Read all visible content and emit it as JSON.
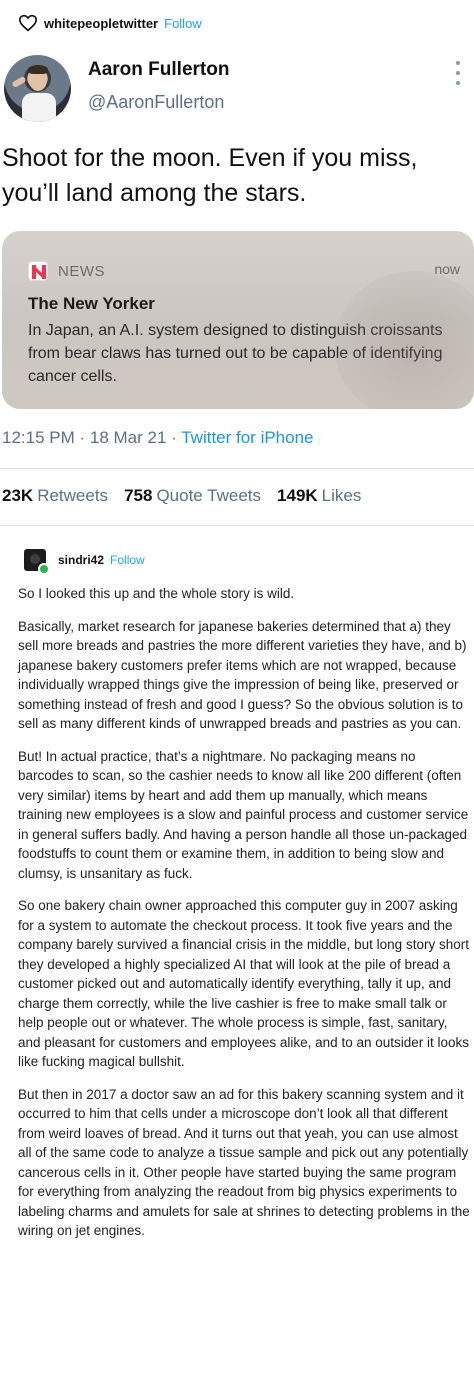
{
  "repost": {
    "username": "whitepeopletwitter",
    "follow_label": "Follow"
  },
  "tweet": {
    "author_name": "Aaron Fullerton",
    "author_handle": "@AaronFullerton",
    "text": "Shoot for the moon. Even if you miss, you’ll land among the stars.",
    "notification": {
      "app": "NEWS",
      "time": "now",
      "title": "The New Yorker",
      "body": "In Japan, an A.I. system designed to distinguish croissants from bear claws has turned out to be capable of identifying cancer cells."
    },
    "timestamp": "12:15 PM · 18 Mar 21 · ",
    "source": "Twitter for iPhone",
    "retweets_count": "23K",
    "retweets_label": "Retweets",
    "quotes_count": "758",
    "quotes_label": "Quote Tweets",
    "likes_count": "149K",
    "likes_label": "Likes"
  },
  "reply": {
    "username": "sindri42",
    "follow_label": "Follow",
    "paragraphs": [
      "So I looked this up and the whole story is wild.",
      "Basically, market research for japanese bakeries determined that a) they sell more breads and pastries the more different varieties they have, and b) japanese bakery customers prefer items which are not wrapped, because individually wrapped things give the impression of being like, preserved or something instead of fresh and good I guess? So the obvious solution is to sell as many different kinds of unwrapped breads and pastries as you can.",
      "But! In actual practice, that’s a nightmare. No packaging means no barcodes to scan, so the cashier needs to know all like 200 different (often very similar) items by heart and add them up manually, which means training new employees is a slow and painful process and customer service in general suffers badly. And having a person handle all those un-packaged foodstuffs to count them or examine them, in addition to being slow and clumsy, is unsanitary as fuck.",
      "So one bakery chain owner approached this computer guy in 2007 asking for a system to automate the checkout process. It took five years and the company barely survived a financial crisis in the middle, but long story short they developed a highly specialized AI that will look at the pile of bread a customer picked out and automatically identify everything, tally it up, and charge them correctly, while the live cashier is free to make small talk or help people out or whatever. The whole process is simple, fast, sanitary, and pleasant for customers and employees alike, and to an outsider it looks like fucking magical bullshit.",
      "But then in 2017 a doctor saw an ad for this bakery scanning system and it occurred to him that cells under a microscope don’t look all that different from weird loaves of bread. And it turns out that yeah, you can use almost all of the same code to analyze a tissue sample and pick out any potentially cancerous cells in it. Other people have started buying the same program for everything from analyzing the readout from big physics experiments to labeling charms and amulets for sale at shrines to detecting problems in the wiring on jet engines."
    ]
  },
  "colors": {
    "link_blue": "#1fa1f2",
    "muted_gray": "#5b7083",
    "news_red": "#f5314d",
    "online_green": "#2bb54a"
  }
}
